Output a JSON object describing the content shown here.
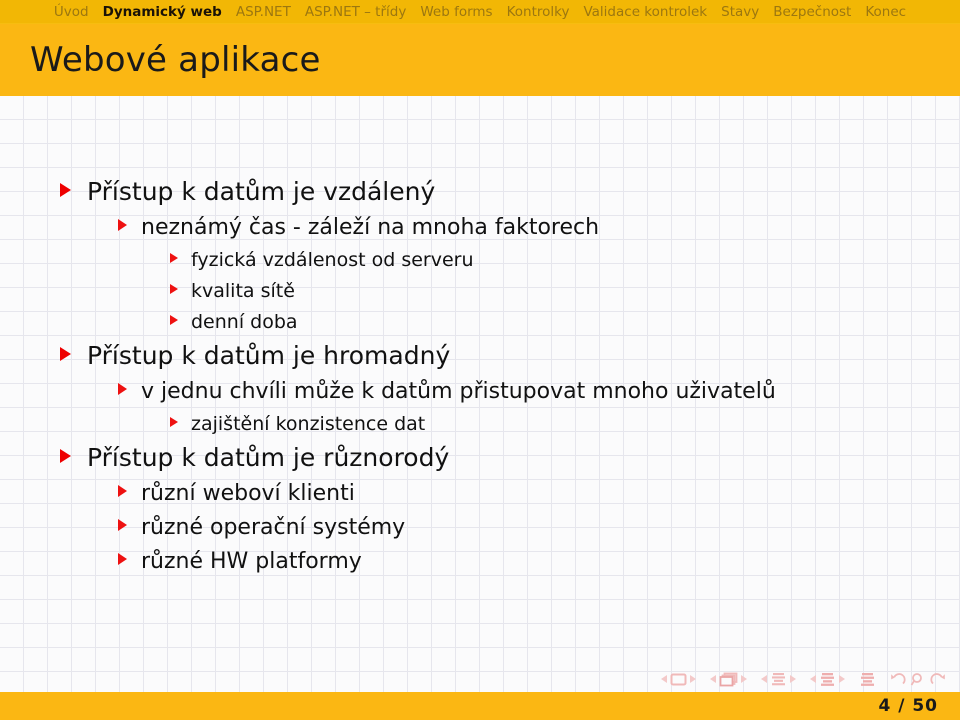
{
  "navbar": {
    "items": [
      {
        "label": "Úvod",
        "active": false
      },
      {
        "label": "Dynamický web",
        "active": true
      },
      {
        "label": "ASP.NET",
        "active": false
      },
      {
        "label": "ASP.NET – třídy",
        "active": false
      },
      {
        "label": "Web forms",
        "active": false
      },
      {
        "label": "Kontrolky",
        "active": false
      },
      {
        "label": "Validace kontrolek",
        "active": false
      },
      {
        "label": "Stavy",
        "active": false
      },
      {
        "label": "Bezpečnost",
        "active": false
      },
      {
        "label": "Konec",
        "active": false
      }
    ]
  },
  "title": "Webové aplikace",
  "bullets": [
    {
      "level": 1,
      "text": "Přístup k datům je vzdálený"
    },
    {
      "level": 2,
      "text": "neznámý čas - záleží na mnoha faktorech"
    },
    {
      "level": 3,
      "text": "fyzická vzdálenost od serveru"
    },
    {
      "level": 3,
      "text": "kvalita sítě"
    },
    {
      "level": 3,
      "text": "denní doba"
    },
    {
      "level": 1,
      "text": "Přístup k datům je hromadný"
    },
    {
      "level": 2,
      "text": "v jednu chvíli může k datům přistupovat mnoho uživatelů"
    },
    {
      "level": 3,
      "text": "zajištění konzistence dat"
    },
    {
      "level": 1,
      "text": "Přístup k datům je různorodý"
    },
    {
      "level": 2,
      "text": "různí weboví klienti"
    },
    {
      "level": 2,
      "text": "různé operační systémy"
    },
    {
      "level": 2,
      "text": "různé HW platformy"
    }
  ],
  "footer": {
    "page_current": "4",
    "page_separator": "/",
    "page_total": "50",
    "page_label": "4 / 50",
    "icons": [
      "prev-slide-icon",
      "slide-icon",
      "next-slide-icon",
      "prev-frame-icon",
      "frame-icon",
      "next-frame-icon",
      "prev-subsection-icon",
      "subsection-icon",
      "next-subsection-icon",
      "prev-section-icon",
      "section-icon",
      "next-section-icon",
      "presentation-icon",
      "back-icon",
      "search-icon",
      "forward-icon"
    ]
  },
  "colors": {
    "navbar_bg": "#f2b705",
    "title_bg": "#fbb713",
    "footer_bg": "#fbb713",
    "bullet_red": "#ee0000",
    "nav_inactive_text": "#9c7710",
    "nav_active_text": "#1a1207",
    "grid_line": "#e6e6ed",
    "body_bg": "#fbfbfc",
    "nav_icon": "#f3c9c9"
  }
}
